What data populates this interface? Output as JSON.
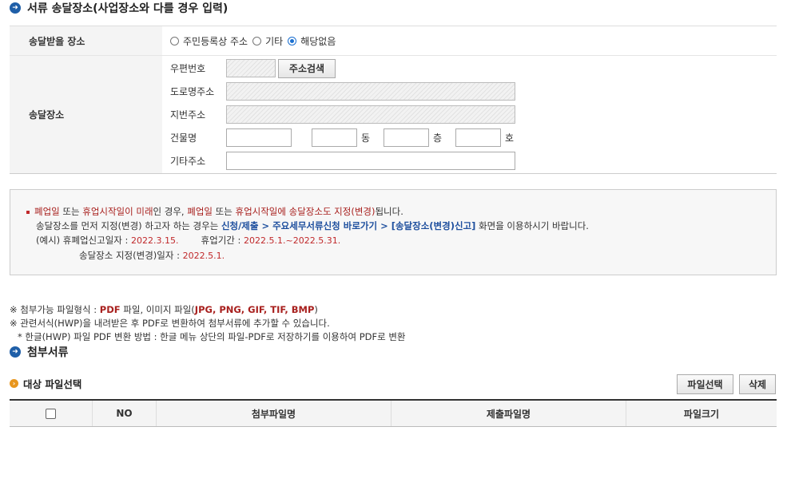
{
  "section": {
    "title": "서류 송달장소(사업장소와 다를 경우 입력)"
  },
  "delivery_place": {
    "label": "송달받을 장소",
    "options": [
      {
        "label": "주민등록상 주소",
        "selected": false
      },
      {
        "label": "기타",
        "selected": false
      },
      {
        "label": "해당없음",
        "selected": true
      }
    ]
  },
  "address": {
    "label": "송달장소",
    "postal_label": "우편번호",
    "search_button": "주소검색",
    "road_label": "도로명주소",
    "lot_label": "지번주소",
    "building_label": "건물명",
    "dong": "동",
    "floor": "층",
    "ho": "호",
    "etc_label": "기타주소"
  },
  "notice": {
    "l1a": "폐업일",
    "l1b": " 또는 ",
    "l1c": "휴업시작일이 미래",
    "l1d": "인 경우, ",
    "l1e": "폐업일",
    "l1f": " 또는 ",
    "l1g": "휴업시작일에 송달장소도 지정(변경)",
    "l1h": "됩니다.",
    "l2a": "송달장소를 먼저 지정(변경) 하고자 하는 경우는 ",
    "l2b": "신청/제출 > 주요세무서류신청 바로가기 > [송달장소(변경)신고]",
    "l2c": " 화면을 이용하시기 바랍니다.",
    "l3a": "(예시) 휴폐업신고일자 : ",
    "l3b": "2022.3.15.",
    "l3c": "휴업기간 : ",
    "l3d": "2022.5.1.~2022.5.31.",
    "l4a": "송달장소 지정(변경)일자 : ",
    "l4b": "2022.5.1."
  },
  "info": {
    "l1a": "※ 첨부가능 파일형식 : ",
    "l1b": "PDF",
    "l1c": " 파일, 이미지 파일(",
    "l1d": "JPG, PNG, GIF, TIF, BMP",
    "l1e": ")",
    "l2": "※ 관련서식(HWP)을 내려받은 후 PDF로 변환하여 첨부서류에 추가할 수 있습니다.",
    "l3": "* 한글(HWP) 파일 PDF 변환 방법 : 한글 메뉴 상단의 파일-PDF로 저장하기를 이용하여 PDF로 변환"
  },
  "attachments": {
    "title": "첨부서류",
    "subtitle": "대상 파일선택",
    "select_button": "파일선택",
    "delete_button": "삭제",
    "columns": [
      "NO",
      "첨부파일명",
      "제출파일명",
      "파일크기"
    ]
  },
  "colors": {
    "accent": "#1f5fa8",
    "warning": "#a8201e",
    "link": "#1e4f9e"
  }
}
